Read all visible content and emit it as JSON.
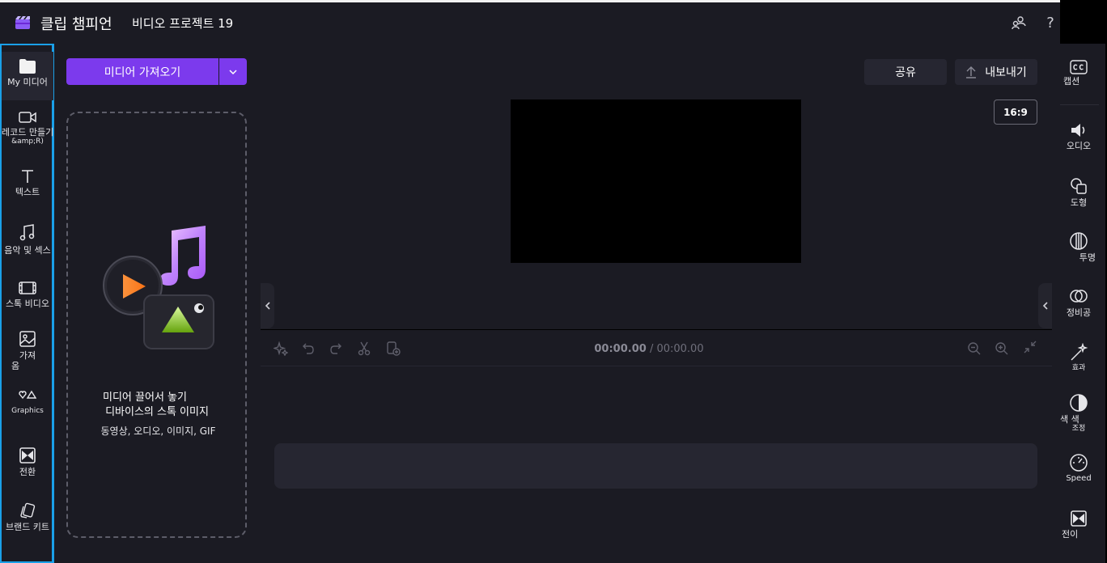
{
  "titlebar": {
    "app_name": "클립 챔피언",
    "project_name": "비디오 프로젝트 19",
    "help_label": "?"
  },
  "leftnav": {
    "items": [
      {
        "label": "My 미디어",
        "icon": "folder-icon",
        "active": true
      },
      {
        "label": "레코드 만들기(",
        "sublabel": "&amp;R)",
        "icon": "video-camera-icon"
      },
      {
        "label": "텍스트",
        "icon": "text-icon"
      },
      {
        "label": "음악 및 섹스",
        "icon": "music-note-icon"
      },
      {
        "label": "스톡 비디오",
        "icon": "film-icon"
      },
      {
        "label": "가져",
        "sublabel": "옴",
        "icon": "image-icon"
      },
      {
        "label": "Graphics",
        "icon": "shapes-icon"
      },
      {
        "label": "전환",
        "icon": "transition-icon"
      },
      {
        "label": "브랜드 키트",
        "icon": "brand-kit-icon"
      }
    ]
  },
  "media": {
    "import_label": "미디어 가져오기",
    "drop_line1": "미디어 끌어서 놓기",
    "drop_line2": "디바이스의 스톡 이미지",
    "drop_line3": "동영상, 오디오, 이미지, GIF"
  },
  "stage": {
    "share_label": "공유",
    "export_label": "내보내기",
    "aspect_label": "16:9"
  },
  "timeline": {
    "current_time": "00:00.00",
    "total_time": "/ 00:00.00"
  },
  "rightnav": {
    "items": [
      {
        "label": "캡션",
        "icon": "captions-icon"
      },
      {
        "label": "오디오",
        "icon": "speaker-icon"
      },
      {
        "label": "도형",
        "icon": "shapes-icon"
      },
      {
        "label": "투명",
        "icon": "transparency-icon"
      },
      {
        "label": "정비공",
        "icon": "filters-icon"
      },
      {
        "label": "효과",
        "icon": "magic-wand-icon"
      },
      {
        "label": "색 색",
        "sublabel": "조정",
        "icon": "color-adjust-icon"
      },
      {
        "label": "Speed",
        "icon": "speedometer-icon"
      },
      {
        "label": "전이",
        "icon": "transition-icon"
      }
    ]
  },
  "colors": {
    "accent": "#7c3aed",
    "panel": "#1b1b23",
    "nav_border": "#1aa0e8"
  }
}
